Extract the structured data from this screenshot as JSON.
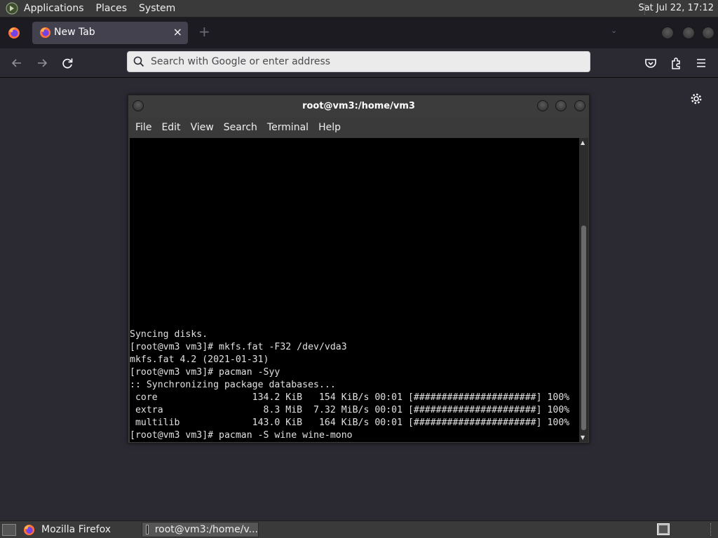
{
  "top_panel": {
    "menu": [
      "Applications",
      "Places",
      "System"
    ],
    "clock": "Sat Jul 22, 17:12"
  },
  "browser": {
    "tab_label": "New Tab",
    "tab_close": "×",
    "new_tab": "+",
    "url_placeholder": "Search with Google or enter address",
    "colors": {
      "frame": "#1c1b22",
      "toolbar": "#2b2a33",
      "tab": "#42414d"
    }
  },
  "terminal": {
    "title": "root@vm3:/home/vm3",
    "menu": [
      "File",
      "Edit",
      "View",
      "Search",
      "Terminal",
      "Help"
    ],
    "lines": [
      "Syncing disks.",
      "[root@vm3 vm3]# mkfs.fat -F32 /dev/vda3",
      "mkfs.fat 4.2 (2021-01-31)",
      "[root@vm3 vm3]# pacman -Syy",
      ":: Synchronizing package databases...",
      " core                 134.2 KiB   154 KiB/s 00:01 [######################] 100%",
      " extra                  8.3 MiB  7.32 MiB/s 00:01 [######################] 100%",
      " multilib             143.0 KiB   164 KiB/s 00:01 [######################] 100%",
      "[root@vm3 vm3]# pacman -S wine wine-mono"
    ]
  },
  "taskbar": {
    "items": [
      "Mozilla Firefox",
      "root@vm3:/home/v..."
    ]
  }
}
